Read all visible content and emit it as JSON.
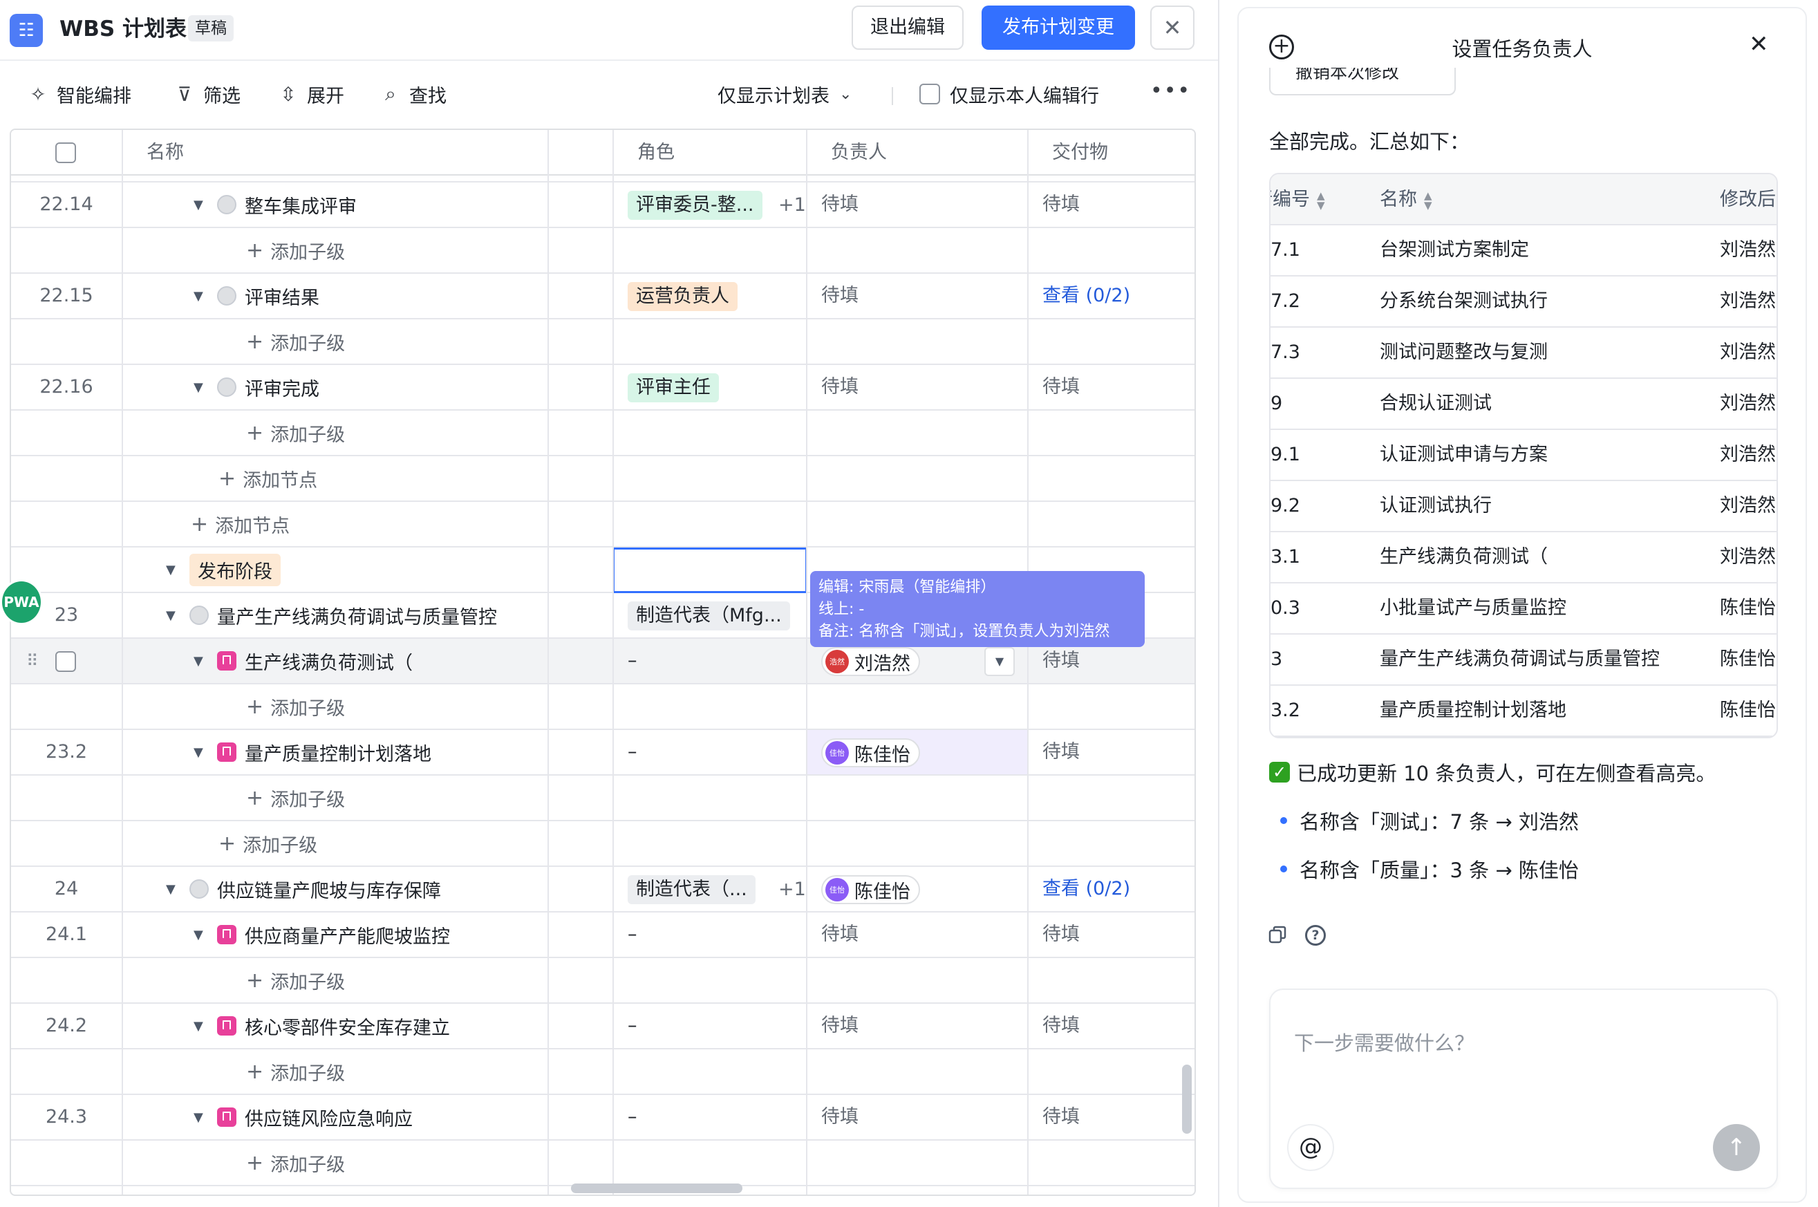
{
  "header": {
    "app_title": "WBS 计划表",
    "draft_badge": "草稿",
    "exit_edit": "退出编辑",
    "publish": "发布计划变更",
    "close": "✕"
  },
  "toolbar": {
    "smart_arrange": "智能编排",
    "filter": "筛选",
    "expand": "展开",
    "find": "查找",
    "view_select": "仅显示计划表",
    "only_mine": "仅显示本人编辑行",
    "more": "•••"
  },
  "columns": {
    "name": "名称",
    "role": "角色",
    "owner": "负责人",
    "deliverable": "交付物"
  },
  "rows": {
    "r1": {
      "num": "22.14",
      "name": "整车集成评审",
      "role": "评审委员-整...",
      "role_more": "+1",
      "owner": "待填",
      "deliverable": "待填"
    },
    "r2": {
      "add": "添加子级"
    },
    "r3": {
      "num": "22.15",
      "name": "评审结果",
      "role": "运营负责人",
      "owner": "待填",
      "deliverable": "查看 (0/2)"
    },
    "r4": {
      "add": "添加子级"
    },
    "r5": {
      "num": "22.16",
      "name": "评审完成",
      "role": "评审主任",
      "owner": "待填",
      "deliverable": "待填"
    },
    "r6": {
      "add": "添加子级"
    },
    "r7": {
      "add": "添加节点"
    },
    "r8": {
      "add": "添加节点"
    },
    "r9": {
      "name": "发布阶段"
    },
    "r10": {
      "num": "23",
      "name": "量产生产线满负荷调试与质量管控",
      "role": "制造代表（Mfg..."
    },
    "r11": {
      "name": "生产线满负荷测试（",
      "role": "–",
      "owner": "刘浩然",
      "owner_avatar": "浩然",
      "deliverable": "待填"
    },
    "r12": {
      "add": "添加子级"
    },
    "r13": {
      "num": "23.2",
      "name": "量产质量控制计划落地",
      "role": "–",
      "owner": "陈佳怡",
      "owner_avatar": "佳怡",
      "deliverable": "待填"
    },
    "r14": {
      "add": "添加子级"
    },
    "r15": {
      "add": "添加子级"
    },
    "r16": {
      "num": "24",
      "name": "供应链量产爬坡与库存保障",
      "role": "制造代表（...",
      "role_more": "+1",
      "owner": "陈佳怡",
      "owner_avatar": "佳怡",
      "deliverable": "查看 (0/2)"
    },
    "r17": {
      "num": "24.1",
      "name": "供应商量产产能爬坡监控",
      "role": "–",
      "owner": "待填",
      "deliverable": "待填"
    },
    "r18": {
      "add": "添加子级"
    },
    "r19": {
      "num": "24.2",
      "name": "核心零部件安全库存建立",
      "role": "–",
      "owner": "待填",
      "deliverable": "待填"
    },
    "r20": {
      "add": "添加子级"
    },
    "r21": {
      "num": "24.3",
      "name": "供应链风险应急响应",
      "role": "–",
      "owner": "待填",
      "deliverable": "待填"
    },
    "r22": {
      "add": "添加子级"
    }
  },
  "tooltip": {
    "line1": "编辑: 宋雨晨（智能编排）",
    "line2": "线上: -",
    "line3": "备注: 名称含「测试」，设置负责人为刘浩然"
  },
  "floating_avatar": "PWA",
  "right_panel": {
    "title": "设置任务负责人",
    "undo": "撤销本次修改",
    "summary": "全部完成。汇总如下：",
    "table": {
      "headers": {
        "code": "行编号",
        "name": "名称",
        "changed": "修改后"
      },
      "rows": [
        {
          "code": "7.1",
          "name": "台架测试方案制定",
          "changed": "刘浩然"
        },
        {
          "code": "7.2",
          "name": "分系统台架测试执行",
          "changed": "刘浩然"
        },
        {
          "code": "7.3",
          "name": "测试问题整改与复测",
          "changed": "刘浩然"
        },
        {
          "code": "9",
          "name": "合规认证测试",
          "changed": "刘浩然"
        },
        {
          "code": "9.1",
          "name": "认证测试申请与方案",
          "changed": "刘浩然"
        },
        {
          "code": "9.2",
          "name": "认证测试执行",
          "changed": "刘浩然"
        },
        {
          "code": "3.1",
          "name": "生产线满负荷测试（",
          "changed": "刘浩然"
        },
        {
          "code": "0.3",
          "name": "小批量试产与质量监控",
          "changed": "陈佳怡"
        },
        {
          "code": "3",
          "name": "量产生产线满负荷调试与质量管控",
          "changed": "陈佳怡"
        },
        {
          "code": "3.2",
          "name": "量产质量控制计划落地",
          "changed": "陈佳怡"
        }
      ]
    },
    "success": "已成功更新 10 条负责人，可在左侧查看高亮。",
    "bullet1": "名称含「测试」：7 条 → 刘浩然",
    "bullet2": "名称含「质量」：3 条 → 陈佳怡",
    "input_placeholder": "下一步需要做什么？",
    "at": "@",
    "send": "↑"
  },
  "colors": {
    "primary": "#3370ff",
    "link": "#245bdb",
    "success": "#2ea121",
    "tooltip": "#7b85f2"
  }
}
